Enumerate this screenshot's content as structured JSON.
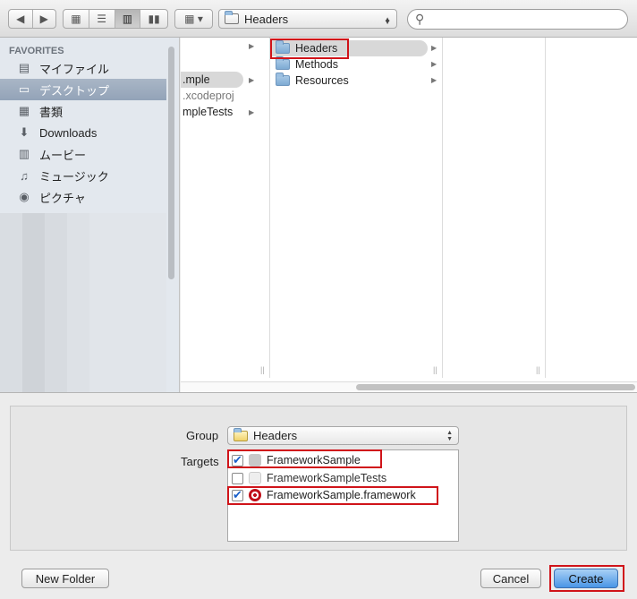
{
  "toolbar": {
    "back_icon": "◀",
    "forward_icon": "▶",
    "view_icons": [
      "grid-view-icon",
      "list-view-icon",
      "column-view-icon",
      "coverflow-view-icon"
    ],
    "path_label": "Headers",
    "search_placeholder": ""
  },
  "sidebar": {
    "heading": "FAVORITES",
    "items": [
      {
        "label": "マイファイル",
        "icon": "all-files-icon",
        "glyph": "▤",
        "selected": false
      },
      {
        "label": "デスクトップ",
        "icon": "desktop-icon",
        "glyph": "▭",
        "selected": true
      },
      {
        "label": "書類",
        "icon": "documents-icon",
        "glyph": "▦",
        "selected": false
      },
      {
        "label": "Downloads",
        "icon": "downloads-icon",
        "glyph": "⬇",
        "selected": false
      },
      {
        "label": "ムービー",
        "icon": "movies-icon",
        "glyph": "▥",
        "selected": false
      },
      {
        "label": "ミュージック",
        "icon": "music-icon",
        "glyph": "♫",
        "selected": false
      },
      {
        "label": "ピクチャ",
        "icon": "pictures-icon",
        "glyph": "◉",
        "selected": false
      }
    ]
  },
  "columns": {
    "col1": [
      ".mple",
      ".xcodeproj",
      "mpleTests"
    ],
    "col2": [
      "Headers",
      "Methods",
      "Resources"
    ]
  },
  "form": {
    "group_label": "Group",
    "group_value": "Headers",
    "targets_label": "Targets",
    "targets": [
      {
        "name": "FrameworkSample",
        "checked": true
      },
      {
        "name": "FrameworkSampleTests",
        "checked": false
      },
      {
        "name": "FrameworkSample.framework",
        "checked": true
      }
    ]
  },
  "buttons": {
    "new_folder": "New Folder",
    "cancel": "Cancel",
    "create": "Create"
  },
  "colors": {
    "highlight": "#d0141a",
    "selection": "#93a3b8",
    "primary_button": "#4a96e6"
  }
}
